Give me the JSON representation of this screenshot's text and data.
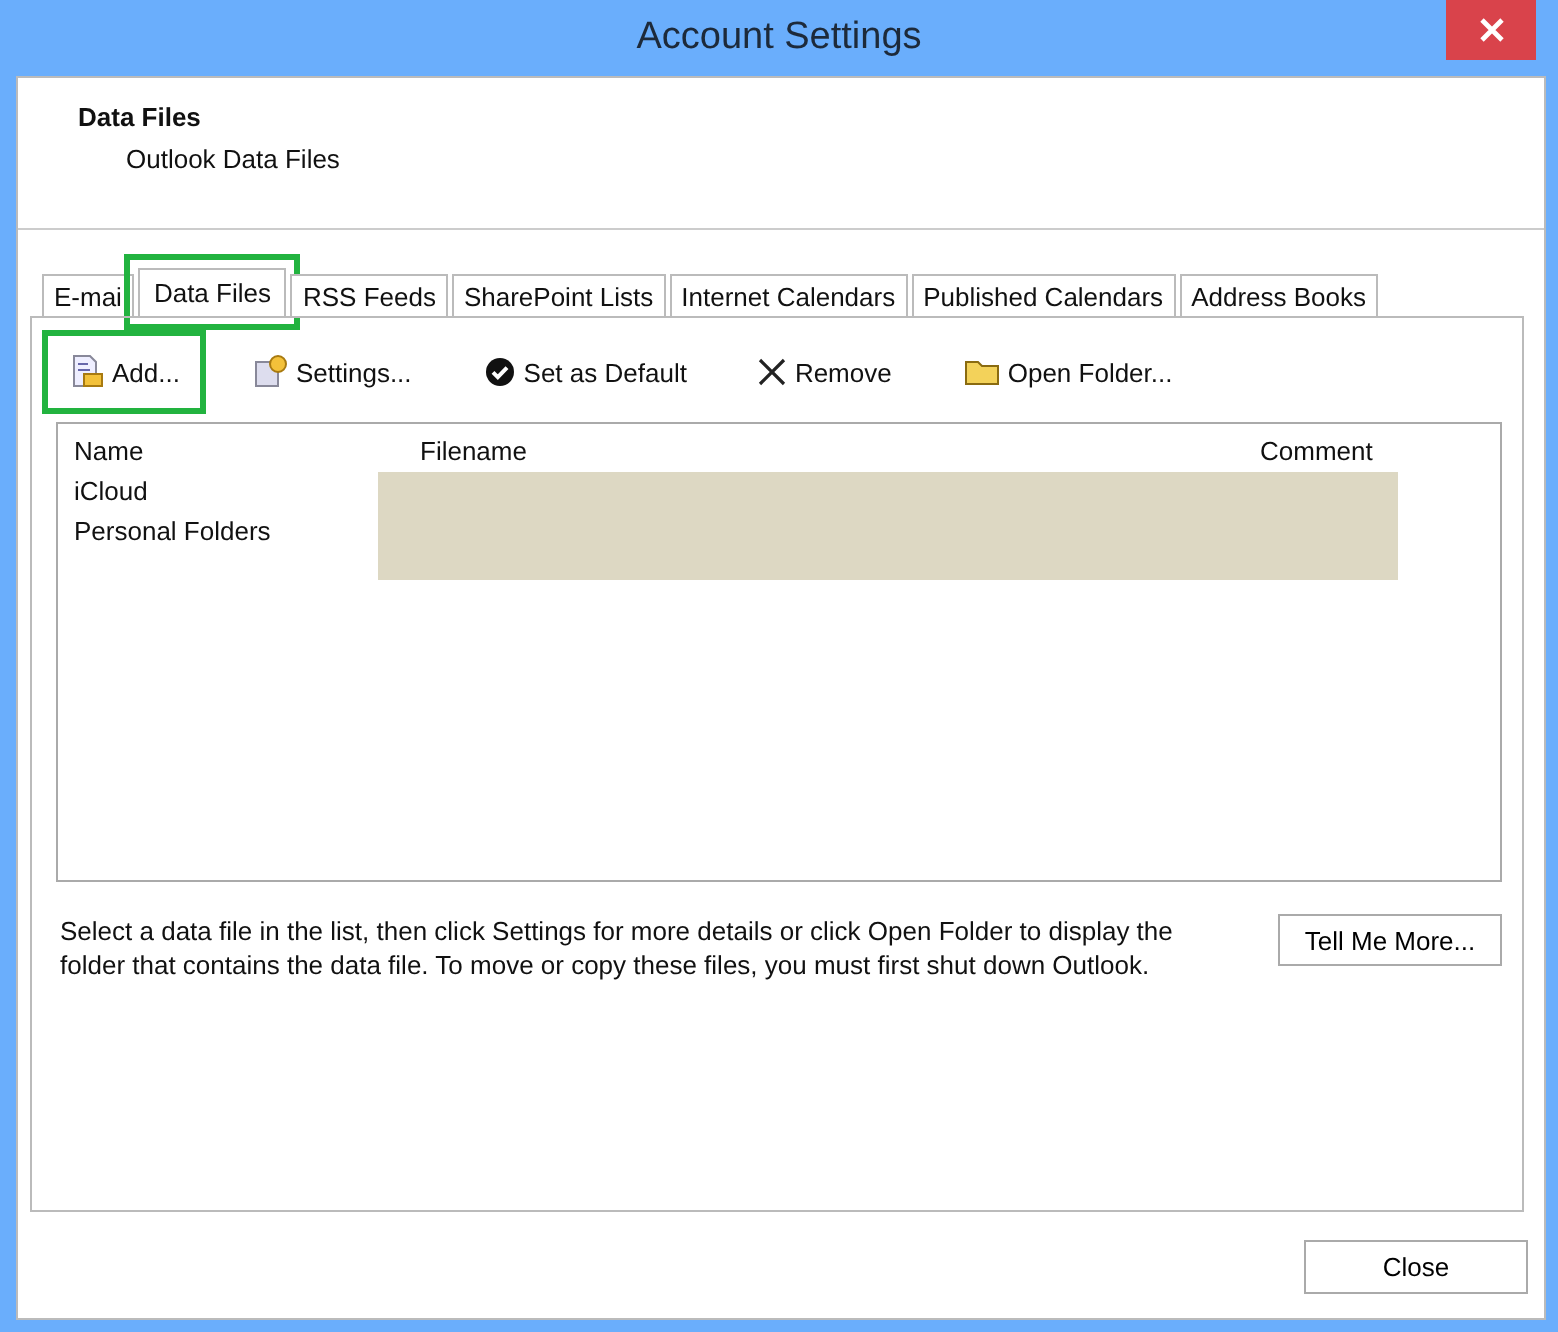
{
  "window": {
    "title": "Account Settings"
  },
  "header": {
    "title": "Data Files",
    "subtitle": "Outlook Data Files"
  },
  "tabs": [
    {
      "label": "E-mai",
      "selected": false,
      "highlighted": false
    },
    {
      "label": "Data Files",
      "selected": true,
      "highlighted": true
    },
    {
      "label": "RSS Feeds",
      "selected": false,
      "highlighted": false
    },
    {
      "label": "SharePoint Lists",
      "selected": false,
      "highlighted": false
    },
    {
      "label": "Internet Calendars",
      "selected": false,
      "highlighted": false
    },
    {
      "label": "Published Calendars",
      "selected": false,
      "highlighted": false
    },
    {
      "label": "Address Books",
      "selected": false,
      "highlighted": false
    }
  ],
  "toolbar": [
    {
      "kind": "add",
      "label": "Add...",
      "highlighted": true
    },
    {
      "kind": "settings",
      "label": "Settings...",
      "highlighted": false
    },
    {
      "kind": "default",
      "label": "Set as Default",
      "highlighted": false
    },
    {
      "kind": "remove",
      "label": "Remove",
      "highlighted": false
    },
    {
      "kind": "folder",
      "label": "Open Folder...",
      "highlighted": false
    }
  ],
  "table": {
    "columns": [
      "Name",
      "Filename",
      "Comment"
    ],
    "rows": [
      {
        "name": "iCloud"
      },
      {
        "name": "Personal Folders"
      }
    ]
  },
  "info_text": "Select a data file in the list, then click Settings for more details or click Open Folder to display the folder that contains the data file. To move or copy these files, you must first shut down Outlook.",
  "tell_more_button": "Tell Me More...",
  "close_button": "Close"
}
